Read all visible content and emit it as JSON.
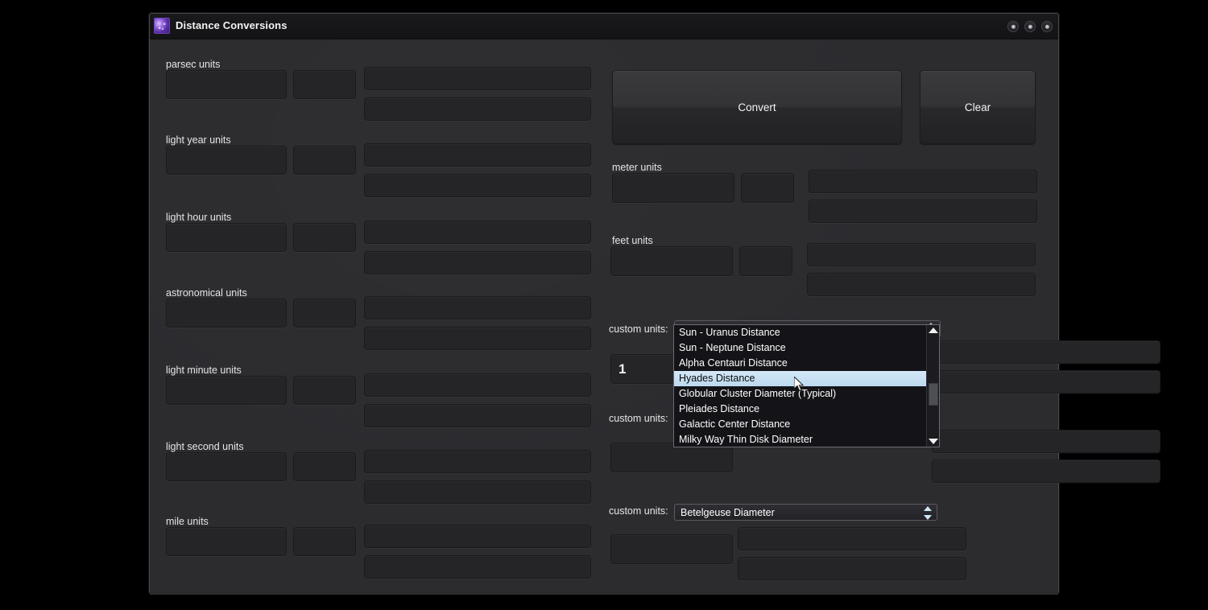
{
  "window": {
    "title": "Distance Conversions",
    "icon": "starfield-app-icon",
    "controls": [
      {
        "name": "minimize-button",
        "glyph": "circle"
      },
      {
        "name": "maximize-button",
        "glyph": "circle"
      },
      {
        "name": "close-button",
        "glyph": "circle"
      }
    ]
  },
  "actions": {
    "convert_label": "Convert",
    "clear_label": "Clear"
  },
  "left_groups": [
    {
      "label": "parsec units",
      "value": "",
      "unit": "",
      "out1": "",
      "out2": ""
    },
    {
      "label": "light year units",
      "value": "",
      "unit": "",
      "out1": "",
      "out2": ""
    },
    {
      "label": "light hour units",
      "value": "",
      "unit": "",
      "out1": "",
      "out2": ""
    },
    {
      "label": "astronomical units",
      "value": "",
      "unit": "",
      "out1": "",
      "out2": ""
    },
    {
      "label": "light minute units",
      "value": "",
      "unit": "",
      "out1": "",
      "out2": ""
    },
    {
      "label": "light second units",
      "value": "",
      "unit": "",
      "out1": "",
      "out2": ""
    },
    {
      "label": "mile units",
      "value": "",
      "unit": "",
      "out1": "",
      "out2": ""
    }
  ],
  "right_groups": [
    {
      "label": "meter units",
      "value": "",
      "unit": "",
      "out1": "",
      "out2": ""
    },
    {
      "label": "feet units",
      "value": "",
      "unit": "",
      "out1": "",
      "out2": ""
    }
  ],
  "custom_rows": [
    {
      "label": "custom units:",
      "selected": "Hyades Distance",
      "value": "1",
      "out1": "",
      "out2": "",
      "expanded": true
    },
    {
      "label": "custom units:",
      "selected": "",
      "value": "",
      "out1": "",
      "out2": "",
      "expanded": false
    },
    {
      "label": "custom units:",
      "selected": "Betelgeuse Diameter",
      "value": "",
      "out1": "",
      "out2": "",
      "expanded": false
    }
  ],
  "dropdown": {
    "options": [
      "Sun - Uranus Distance",
      "Sun - Neptune Distance",
      "Alpha Centauri Distance",
      "Hyades Distance",
      "Globular Cluster Diameter (Typical)",
      "Pleiades Distance",
      "Galactic Center Distance",
      "Milky Way Thin Disk Diameter"
    ],
    "selected_index": 3,
    "scroll_up_icon": "triangle-up-icon",
    "scroll_down_icon": "triangle-down-icon"
  },
  "colors": {
    "window_bg": "#2c2c2f",
    "titlebar": "#16161a",
    "field_bg": "#252528",
    "highlight": "#c9e2f3",
    "accent_icon": "#7b4fd0"
  }
}
